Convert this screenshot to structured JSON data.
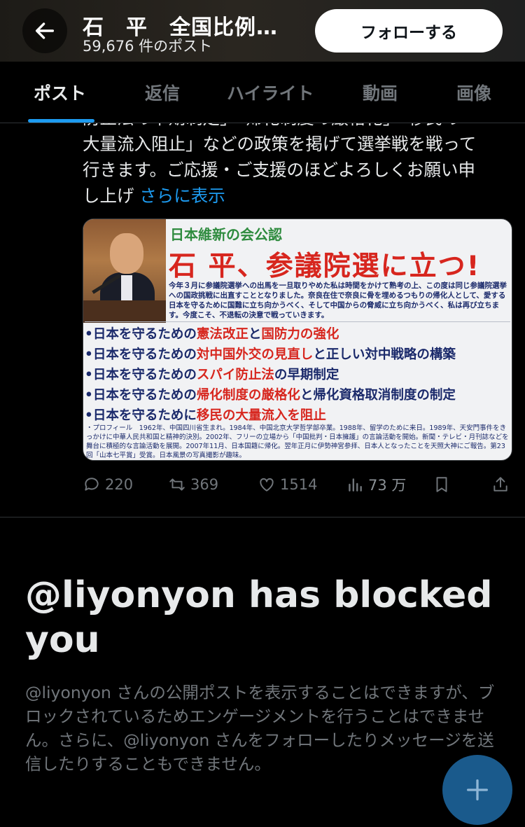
{
  "header": {
    "title": "石　平　全国比例…",
    "post_count": "59,676 件のポスト",
    "follow_label": "フォローする"
  },
  "tabs": [
    {
      "label": "ポスト",
      "active": true
    },
    {
      "label": "返信",
      "active": false
    },
    {
      "label": "ハイライト",
      "active": false
    },
    {
      "label": "動画",
      "active": false
    },
    {
      "label": "画像",
      "active": false
    }
  ],
  "post": {
    "text_partial_top": "防止法の早期制定」「帰化制度の厳格化」「移民の",
    "text_line_2": "大量流入阻止」などの政策を掲げて選挙戦を戦って",
    "text_line_3": "行きます。ご応援・ご支援のほどよろしくお願い申",
    "text_line_4": "し上げ",
    "more_label": "さらに表示",
    "card": {
      "party": "日本維新の会公認",
      "headline": "石 平、参議院選に立つ!",
      "intro": "今年３月に参議院選挙への出馬を一旦取りやめた私は時間をかけて熟考の上、この度は同じ参議院選挙への国政挑戦に出直すこととなりました。奈良在住で奈良に骨を埋めるつもりの帰化人として、愛する日本を守るために国難に立ち向かうべく、そして中国からの脅威に立ち向かうべく、私は再び立ちます。今度こそ、不退転の決意で戦っていきます。",
      "points": [
        {
          "prefix": "•日本を守るための",
          "highlight": "憲法改正",
          "middle": "と",
          "highlight2": "国防力の強化",
          "suffix": ""
        },
        {
          "prefix": "•日本を守るための",
          "highlight": "対中国外交の見直し",
          "middle": "と正しい対中戦略の構築",
          "highlight2": "",
          "suffix": ""
        },
        {
          "prefix": "•日本を守るための",
          "highlight": "スパイ防止法",
          "middle": "の早期制定",
          "highlight2": "",
          "suffix": ""
        },
        {
          "prefix": "•日本を守るための",
          "highlight": "帰化制度の厳格化",
          "middle": "と帰化資格取消制度の制定",
          "highlight2": "",
          "suffix": ""
        },
        {
          "prefix": "•日本を守るために",
          "highlight": "移民の大量流入を阻止",
          "middle": "",
          "highlight2": "",
          "suffix": ""
        }
      ],
      "profile": "・プロフィール　1962年、中国四川省生まれ。1984年、中国北京大学哲学部卒業。1988年、留学のために来日。1989年、天安門事件をきっかけに中華人民共和国と精神的決別。2002年、フリーの立場から「中国批判・日本擁護」の言論活動を開始。新聞・テレビ・月刊誌などを舞台に積極的な言論活動を展開。2007年11月、日本国籍に帰化。翌年正月に伊勢神宮参拝、日本人となったことを天照大神にご報告。第23回「山本七平賞」受賞。日本風景の写真撮影が趣味。"
    },
    "actions": {
      "replies": "220",
      "reposts": "369",
      "likes": "1514",
      "views": "73 万"
    }
  },
  "blocked": {
    "title": "@liyonyon has blocked you",
    "description": "@liyonyon さんの公開ポストを表示することはできますが、ブロックされているためエンゲージメントを行うことはできません。さらに、@liyonyon さんをフォローしたりメッセージを送信したりすることもできません。"
  },
  "icons": {
    "back": "back-arrow-icon",
    "reply": "reply-icon",
    "repost": "repost-icon",
    "like": "heart-icon",
    "views": "views-icon",
    "bookmark": "bookmark-icon",
    "share": "share-icon",
    "compose": "plus-icon"
  },
  "colors": {
    "accent": "#1d9bf0",
    "background": "#000000",
    "muted": "#71767b",
    "card_red": "#d7261e",
    "card_green": "#2e8b3e"
  }
}
